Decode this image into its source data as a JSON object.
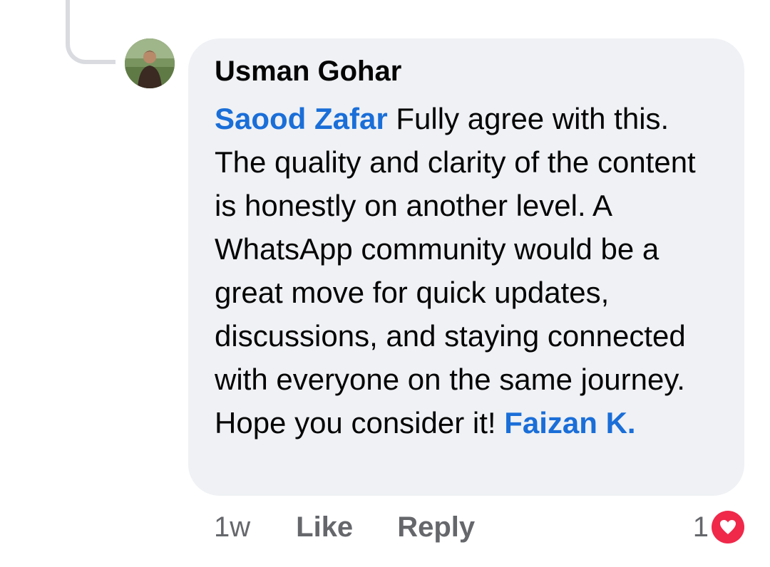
{
  "comment": {
    "author": "Usman Gohar",
    "mention_start": "Saood Zafar",
    "body": "Fully agree with this. The quality and clarity of the content is honestly on another level. A WhatsApp community would be a great move for quick updates, discussions, and staying connected with everyone on the same journey. Hope you consider it!",
    "mention_end": "Faizan K.",
    "time": "1w",
    "like_label": "Like",
    "reply_label": "Reply",
    "reaction_count": "1",
    "reaction_icon": "heart-icon"
  },
  "colors": {
    "mention": "#1a6ed8",
    "bubble": "#eff1f4",
    "heart": "#f0284a",
    "meta_text": "#65676b"
  }
}
